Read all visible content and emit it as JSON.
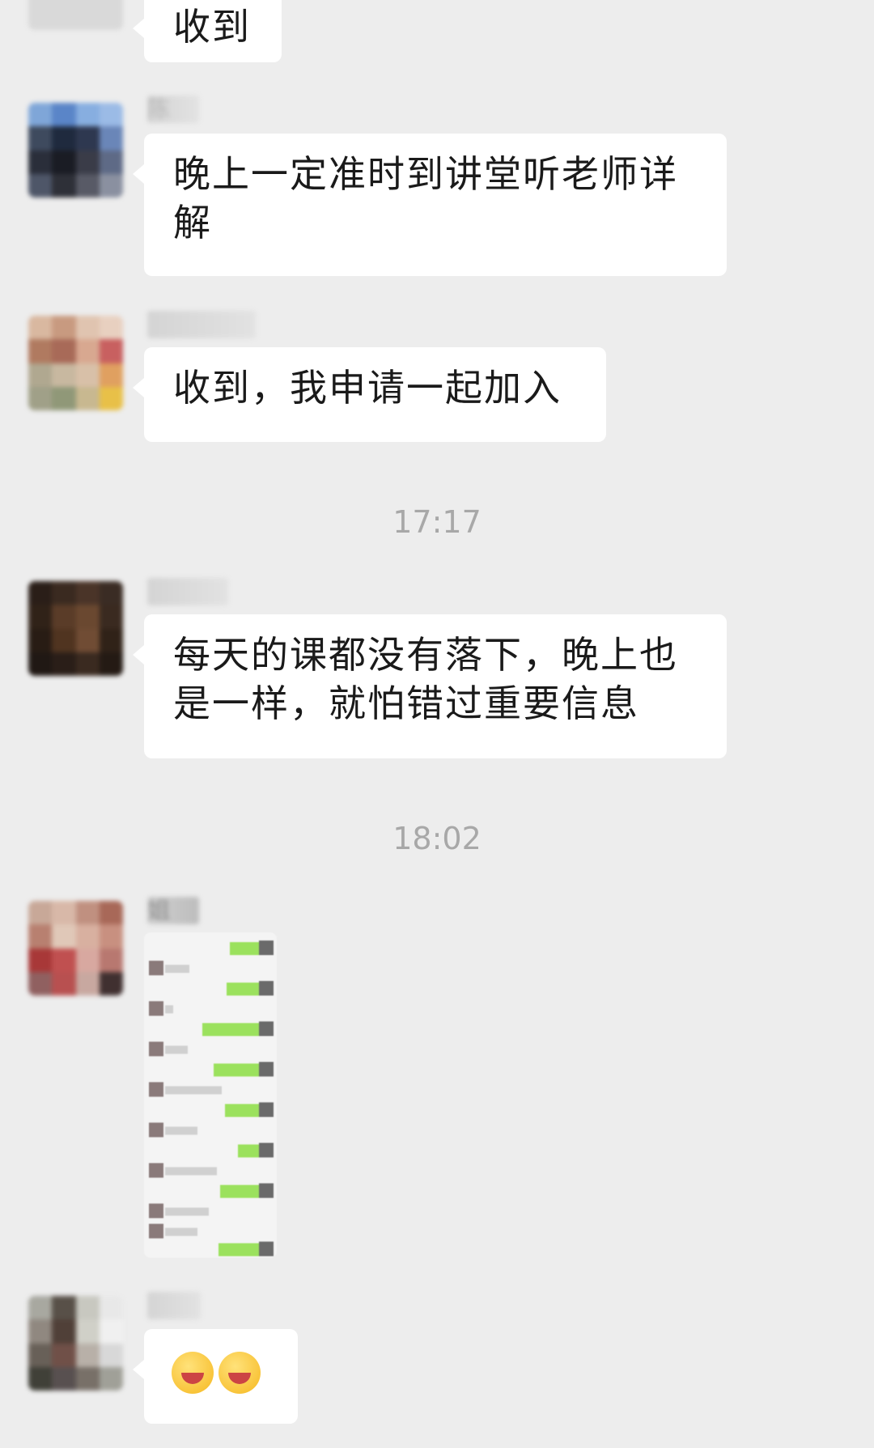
{
  "messages": [
    {
      "type": "text",
      "sender": "",
      "text": "收到"
    },
    {
      "type": "text",
      "sender": "陈",
      "text": "晚上一定准时到讲堂听老师详解"
    },
    {
      "type": "text",
      "sender": "",
      "text": "收到，我申请一起加入"
    },
    {
      "type": "timestamp",
      "text": "17:17"
    },
    {
      "type": "text",
      "sender": "",
      "text": "每天的课都没有落下，晚上也是一样，就怕错过重要信息"
    },
    {
      "type": "timestamp",
      "text": "18:02"
    },
    {
      "type": "image",
      "sender": "姐",
      "alt": "chat screenshot image"
    },
    {
      "type": "emoji",
      "sender": "",
      "emojis": "😁😁"
    }
  ],
  "colors": {
    "background": "#ededed",
    "bubble": "#ffffff",
    "timestamp": "#a8a8a8",
    "wechat_green": "#9be15d"
  }
}
